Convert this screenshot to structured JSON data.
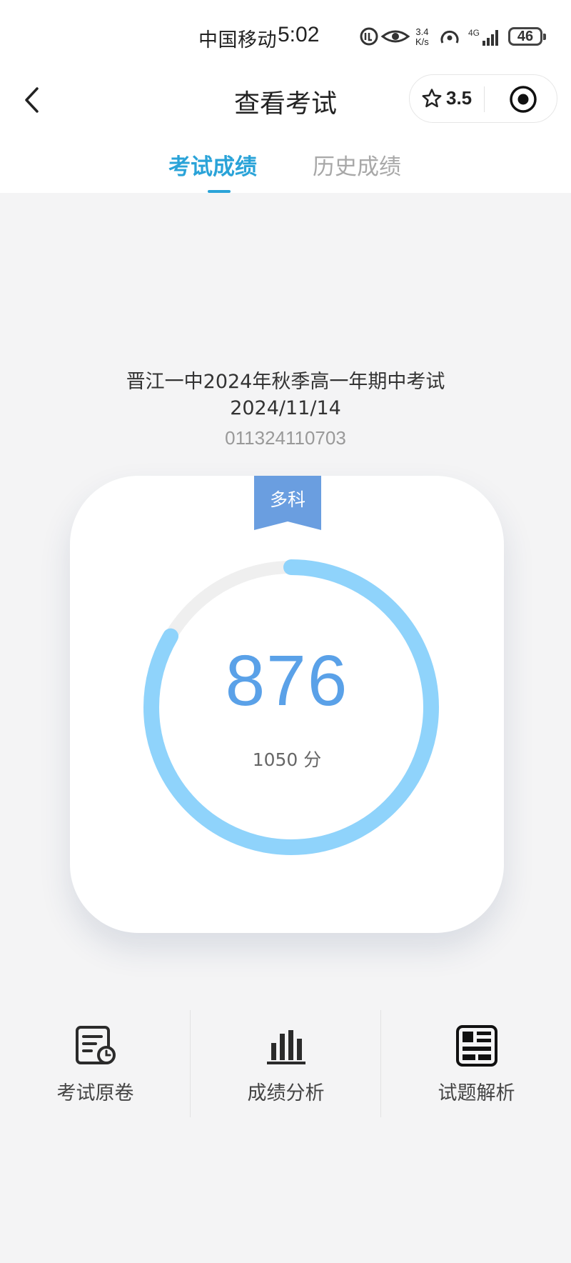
{
  "status_bar": {
    "carrier": "中国移动",
    "time": "5:02",
    "net_speed_value": "3.4",
    "net_speed_unit": "K/s",
    "network": "4G",
    "battery": "46"
  },
  "nav": {
    "title": "查看考试",
    "rating": "3.5"
  },
  "tabs": [
    {
      "label": "考试成绩",
      "active": true
    },
    {
      "label": "历史成绩",
      "active": false
    }
  ],
  "exam": {
    "name": "晋江一中2024年秋季高一年期中考试",
    "date": "2024/11/14",
    "id": "011324110703"
  },
  "score_card": {
    "badge": "多科",
    "score": "876",
    "total": "1050 分",
    "score_value": 876,
    "total_value": 1050
  },
  "actions": [
    {
      "label": "考试原卷",
      "icon": "exam-paper-icon"
    },
    {
      "label": "成绩分析",
      "icon": "bar-chart-icon"
    },
    {
      "label": "试题解析",
      "icon": "grid-list-icon"
    }
  ],
  "colors": {
    "accent": "#2aa3d8",
    "ring": "#8fd3fb",
    "ring_track": "#efefef",
    "score": "#5aa1e8",
    "badge": "#6a9ee0"
  }
}
